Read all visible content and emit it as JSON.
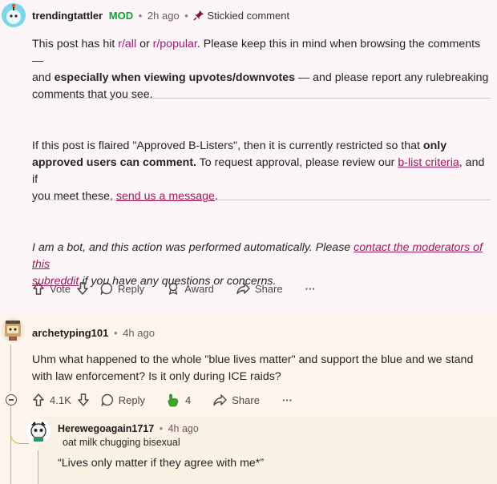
{
  "colors": {
    "background": "#fcf5f7",
    "mod_green": "#1a9b3a",
    "link": "#9b1a5a",
    "thread_line": "#d4b24a",
    "award_green": "#3aa82a"
  },
  "stickied_comment": {
    "author": "trendingtattler",
    "mod_badge": "MOD",
    "time": "2h ago",
    "sticky_label": "Stickied comment",
    "p1": {
      "t1": "This post has hit ",
      "link1": "r/all",
      "t2": " or ",
      "link2": "r/popular",
      "t3": ". Please keep this in mind when browsing the comments —",
      "t4": "and ",
      "bold": "especially when viewing upvotes/downvotes",
      "t5": " — and please report any rulebreaking",
      "t6": "comments that you see."
    },
    "p2": {
      "t1": "If this post is flaired \"Approved B-Listers\", then it is currently restricted so that ",
      "bold1": "only",
      "bold2": "approved users can comment.",
      "t2": " To request approval, please review our ",
      "link1": "b-list criteria",
      "t3": ", and if",
      "t4": "you meet these, ",
      "link2": "send us a message",
      "t5": "."
    },
    "p3": {
      "t1": "I am a bot, and this action was performed automatically. Please ",
      "link1a": "contact the moderators of this",
      "link1b": "subreddit",
      "t2": " if you have any questions or concerns."
    },
    "actions": {
      "vote_label": "Vote",
      "reply_label": "Reply",
      "award_label": "Award",
      "share_label": "Share",
      "more_label": "···"
    }
  },
  "comment1": {
    "author": "archetyping101",
    "time": "4h ago",
    "body_line1": "Uhm what happened to the whole \"blue lives matter\" and support the blue and we stand",
    "body_line2": "with law enforcement? Is it only during ICE raids?",
    "actions": {
      "vote_count": "4.1K",
      "reply_label": "Reply",
      "award_count": "4",
      "share_label": "Share",
      "more_label": "···"
    }
  },
  "comment2": {
    "author": "Herewegoagain1717",
    "time": "4h ago",
    "flair": "oat milk chugging bisexual",
    "body": "“Lives only matter if they agree with me*”"
  }
}
